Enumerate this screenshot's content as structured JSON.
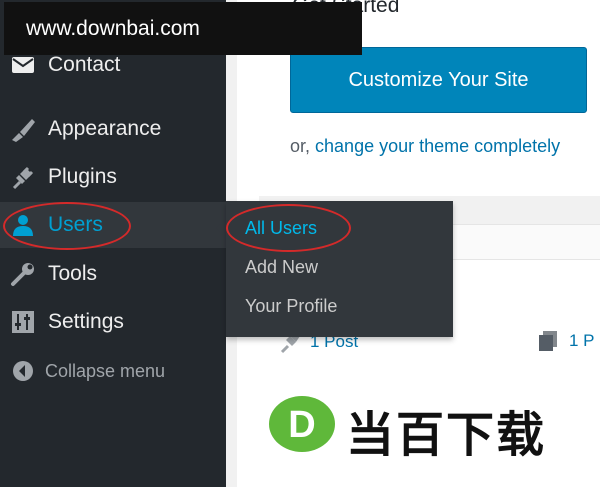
{
  "watermark": {
    "text": "www.downbai.com"
  },
  "sidebar": {
    "items": [
      {
        "label": "Contact",
        "icon": "envelope-icon"
      },
      {
        "label": "Appearance",
        "icon": "paintbrush-icon"
      },
      {
        "label": "Plugins",
        "icon": "plug-icon"
      },
      {
        "label": "Users",
        "icon": "user-icon",
        "active": true
      },
      {
        "label": "Tools",
        "icon": "wrench-icon"
      },
      {
        "label": "Settings",
        "icon": "sliders-icon"
      }
    ],
    "collapse_label": "Collapse menu"
  },
  "users_submenu": {
    "items": [
      {
        "label": "All Users",
        "current": true
      },
      {
        "label": "Add New"
      },
      {
        "label": "Your Profile"
      }
    ]
  },
  "dashboard": {
    "get_started": "Get Started",
    "customize_button": "Customize Your Site",
    "or_prefix": "or,",
    "change_theme_link": "change your theme completely",
    "posts_count": "1 Post",
    "pages_count": "1 P"
  },
  "logo": {
    "letter": "D",
    "text": "当百下载"
  },
  "colors": {
    "sidebar_bg": "#23282d",
    "flyout_bg": "#32373c",
    "accent_blue": "#00a0d2",
    "button_blue": "#0085ba",
    "link_blue": "#0073aa",
    "highlight_red": "#d42a2a",
    "logo_green": "#5fb83a"
  }
}
